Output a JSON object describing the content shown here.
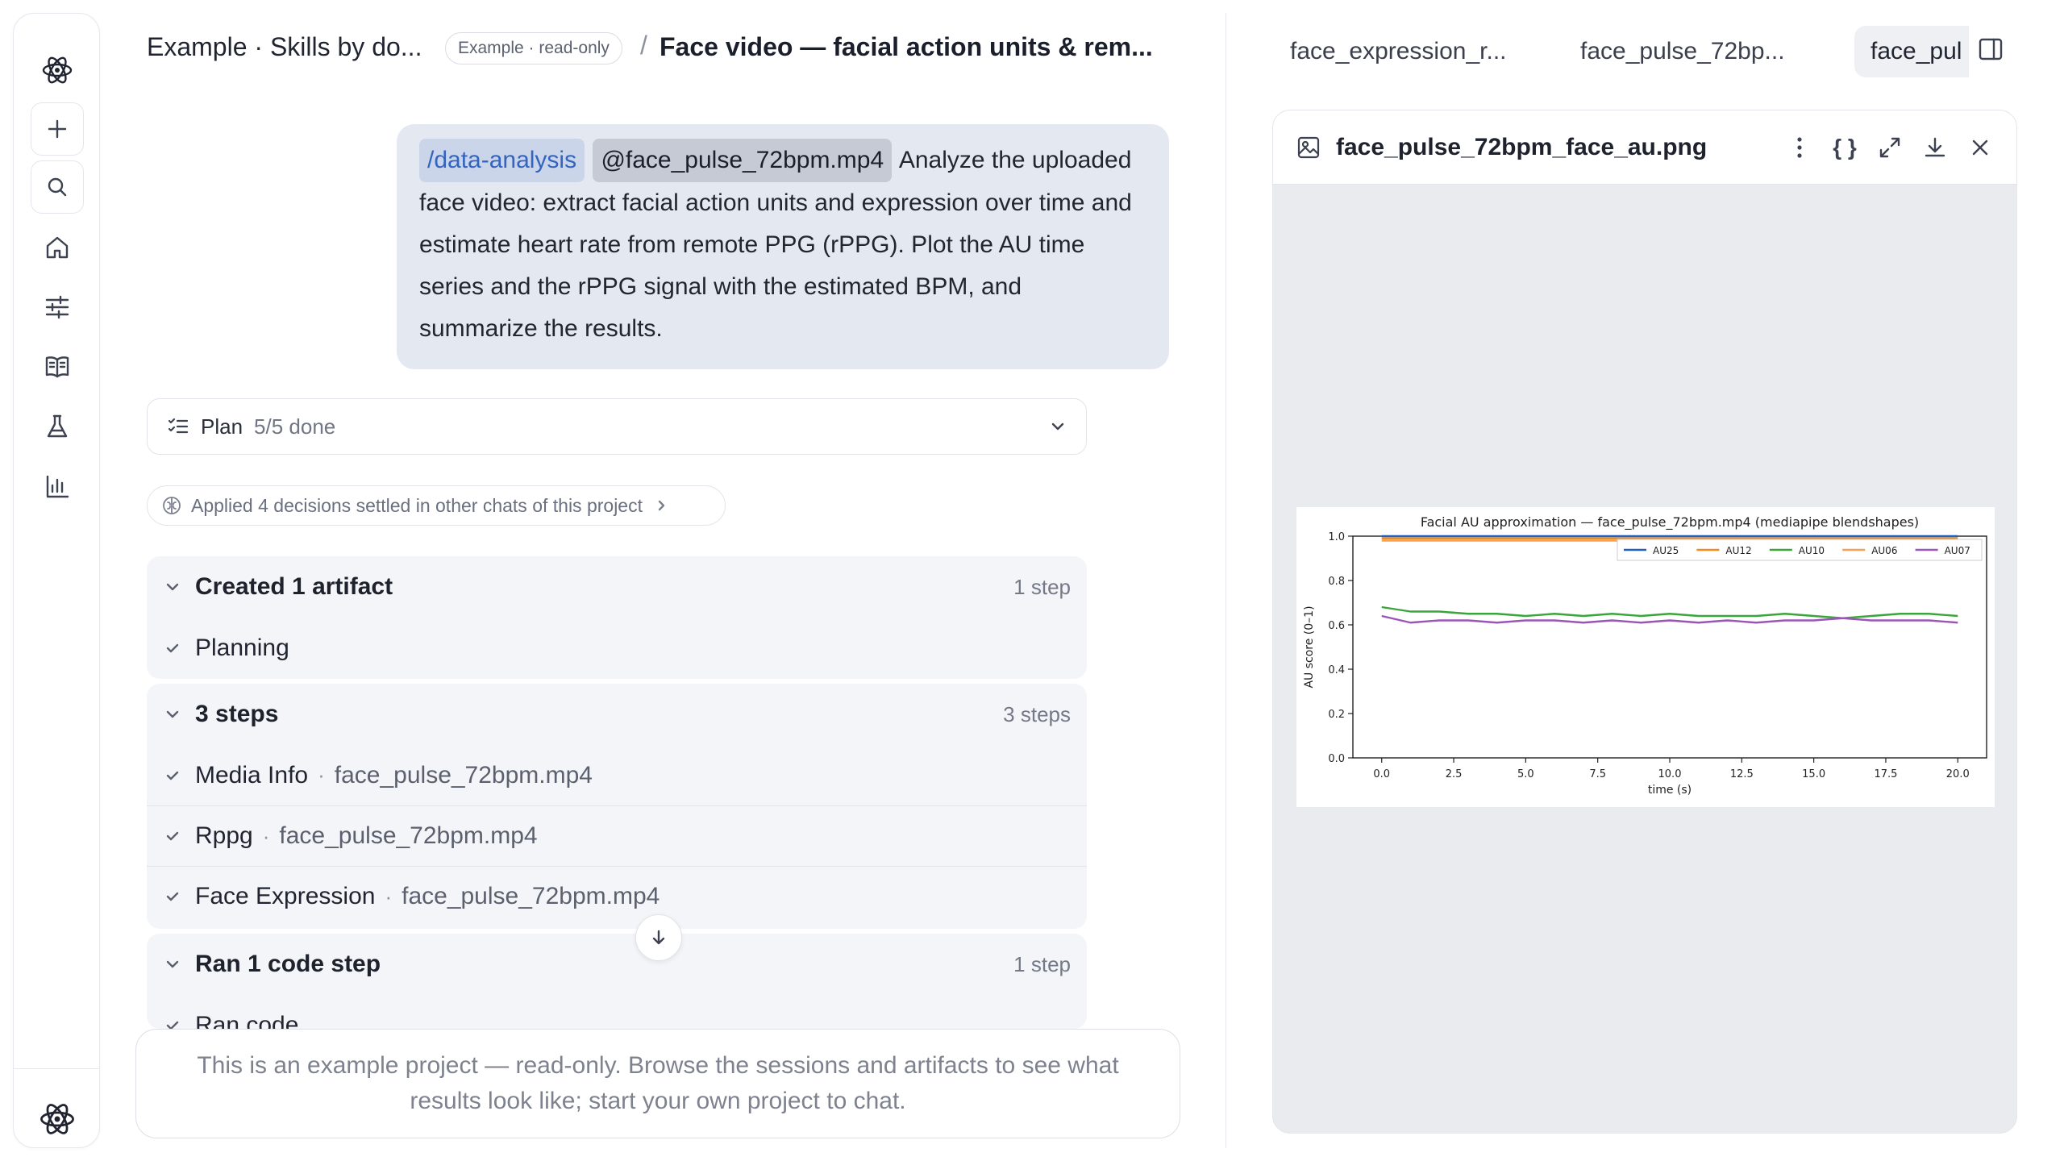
{
  "header": {
    "project": "Example · Skills by do...",
    "badge": "Example · read-only",
    "separator": "/",
    "title": "Face video — facial action units & rem..."
  },
  "message": {
    "skill": "/data-analysis",
    "file": "@face_pulse_72bpm.mp4",
    "text": "Analyze the uploaded face video: extract facial action units and expression over time and estimate heart rate from remote PPG (rPPG). Plot the AU time series and the rPPG signal with the estimated BPM, and summarize the results."
  },
  "plan": {
    "label": "Plan",
    "count": "5/5 done"
  },
  "decisions": {
    "text": "Applied 4 decisions settled in other chats of this project"
  },
  "groups": [
    {
      "title": "Created 1 artifact",
      "meta": "1 step",
      "rows": [
        {
          "name": "Planning",
          "file": ""
        }
      ]
    },
    {
      "title": "3 steps",
      "meta": "3 steps",
      "rows": [
        {
          "name": "Media Info",
          "file": "face_pulse_72bpm.mp4"
        },
        {
          "name": "Rppg",
          "file": "face_pulse_72bpm.mp4"
        },
        {
          "name": "Face Expression",
          "file": "face_pulse_72bpm.mp4"
        }
      ]
    },
    {
      "title": "Ran 1 code step",
      "meta": "1 step",
      "rows": [
        {
          "name": "Ran code",
          "file": ""
        }
      ]
    }
  ],
  "row_separator": "·",
  "readonly_notice": "This is an example project — read-only. Browse the sessions and artifacts to see what results look like; start your own project to chat.",
  "tabs": [
    {
      "label": "face_expression_r..."
    },
    {
      "label": "face_pulse_72bp..."
    },
    {
      "label": "face_pul"
    }
  ],
  "artifact": {
    "filename": "face_pulse_72bpm_face_au.png",
    "json_tool": "{ }"
  },
  "icons": {
    "logo": "atom-icon",
    "new": "plus-icon",
    "search": "search-icon",
    "home": "home-icon",
    "settings": "sliders-icon",
    "library": "book-icon",
    "lab": "flask-icon",
    "stats": "bar-chart-icon"
  },
  "colors": {
    "skill_chip": "#3264c0",
    "message_bg": "#e4e8f1",
    "accent": "#3264c0"
  },
  "chart_data": {
    "type": "line",
    "title": "Facial AU approximation — face_pulse_72bpm.mp4 (mediapipe blendshapes)",
    "xlabel": "time (s)",
    "ylabel": "AU score (0–1)",
    "xlim": [
      -1,
      21
    ],
    "ylim": [
      0,
      1.0
    ],
    "xticks": [
      "0.0",
      "2.5",
      "5.0",
      "7.5",
      "10.0",
      "12.5",
      "15.0",
      "17.5",
      "20.0"
    ],
    "yticks": [
      "0.0",
      "0.2",
      "0.4",
      "0.6",
      "0.8",
      "1.0"
    ],
    "legend": "top-right",
    "x": [
      0,
      1,
      2,
      3,
      4,
      5,
      6,
      7,
      8,
      9,
      10,
      11,
      12,
      13,
      14,
      15,
      16,
      17,
      18,
      19,
      20
    ],
    "series": [
      {
        "name": "AU25",
        "color": "#1f5fbf",
        "values": [
          1.0,
          1.0,
          1.0,
          1.0,
          1.0,
          1.0,
          1.0,
          1.0,
          1.0,
          1.0,
          1.0,
          1.0,
          1.0,
          1.0,
          1.0,
          1.0,
          1.0,
          1.0,
          1.0,
          1.0,
          1.0
        ]
      },
      {
        "name": "AU12",
        "color": "#f28a1c",
        "values": [
          0.99,
          0.99,
          0.99,
          0.99,
          0.99,
          0.99,
          0.99,
          0.99,
          0.99,
          0.99,
          0.99,
          0.99,
          0.99,
          0.99,
          0.99,
          0.99,
          0.99,
          0.99,
          0.99,
          0.99,
          0.99
        ]
      },
      {
        "name": "AU10",
        "color": "#3aa63a",
        "values": [
          0.68,
          0.66,
          0.66,
          0.65,
          0.65,
          0.64,
          0.65,
          0.64,
          0.65,
          0.64,
          0.65,
          0.64,
          0.64,
          0.64,
          0.65,
          0.64,
          0.63,
          0.64,
          0.65,
          0.65,
          0.64
        ]
      },
      {
        "name": "AU06",
        "color": "#f5a055",
        "values": [
          0.98,
          0.98,
          0.98,
          0.98,
          0.98,
          0.98,
          0.98,
          0.98,
          0.98,
          0.98,
          0.98,
          0.98,
          0.98,
          0.98,
          0.98,
          0.98,
          0.98,
          0.98,
          0.98,
          0.98,
          0.98
        ]
      },
      {
        "name": "AU07",
        "color": "#9a55b8",
        "values": [
          0.64,
          0.61,
          0.62,
          0.62,
          0.61,
          0.62,
          0.62,
          0.61,
          0.62,
          0.61,
          0.62,
          0.61,
          0.62,
          0.61,
          0.62,
          0.62,
          0.63,
          0.62,
          0.62,
          0.62,
          0.61
        ]
      }
    ]
  }
}
